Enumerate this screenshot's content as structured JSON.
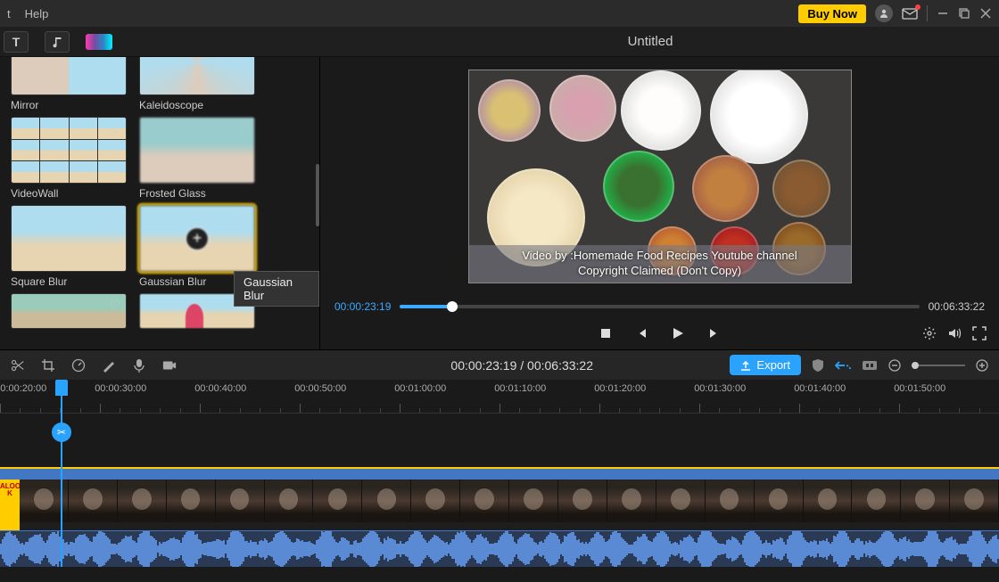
{
  "menubar": {
    "items": [
      "t",
      "Help"
    ],
    "buy_label": "Buy Now"
  },
  "project": {
    "title": "Untitled"
  },
  "effects": {
    "rows": [
      [
        {
          "name": "Mirror",
          "selected": false
        },
        {
          "name": "Kaleidoscope",
          "selected": false
        }
      ],
      [
        {
          "name": "VideoWall",
          "selected": false
        },
        {
          "name": "Frosted Glass",
          "selected": false
        }
      ],
      [
        {
          "name": "Square Blur",
          "selected": false
        },
        {
          "name": "Gaussian Blur",
          "selected": true
        }
      ]
    ],
    "tooltip": "Gaussian Blur"
  },
  "preview": {
    "caption_line1": "Video by :Homemade Food Recipes Youtube channel",
    "caption_line2": "Copyright Claimed (Don't Copy)",
    "time_current": "00:00:23:19",
    "time_duration": "00:06:33:22"
  },
  "timeline": {
    "center_time": "00:00:23:19 / 00:06:33:22",
    "export_label": "Export",
    "ruler": [
      "00:00:20:00",
      "00:00:30:00",
      "00:00:40:00",
      "00:00:50:00",
      "00:01:00:00",
      "00:01:10:00",
      "00:01:20:00",
      "00:01:30:00",
      "00:01:40:00",
      "00:01:50:00"
    ],
    "clip_label": "ALOO K"
  },
  "colors": {
    "accent_blue": "#2aa3ff",
    "accent_yellow": "#ffcc00"
  }
}
